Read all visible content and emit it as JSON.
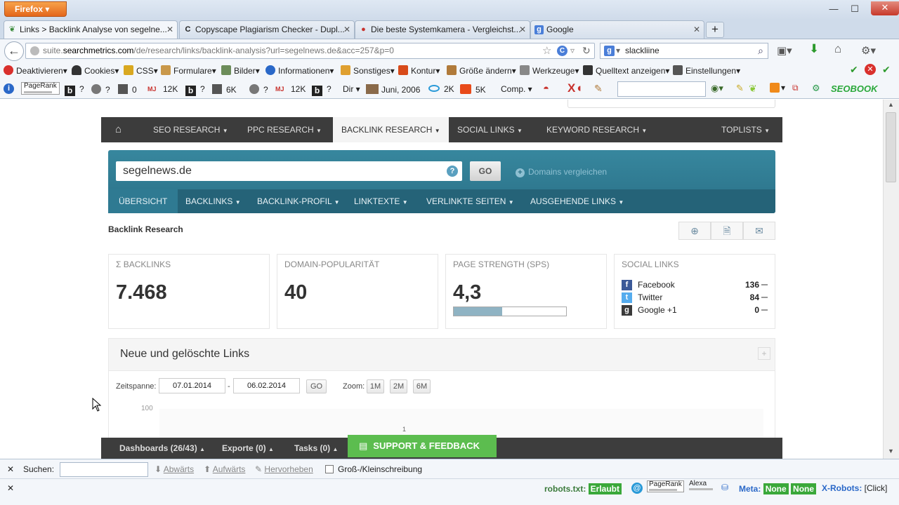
{
  "browser": {
    "app_button": "Firefox",
    "tabs": [
      {
        "label": "Links > Backlink Analyse von segelne...",
        "icon": "leaf-favicon-icon",
        "active": true
      },
      {
        "label": "Copyscape Plagiarism Checker - Dupl...",
        "icon": "copyscape-favicon-icon"
      },
      {
        "label": "Die beste Systemkamera - Vergleichst...",
        "icon": "camera-favicon-icon"
      },
      {
        "label": "Google",
        "icon": "google-favicon-icon"
      }
    ],
    "url_prefix": "suite.",
    "url_domain": "searchmetrics.com",
    "url_path": "/de/research/links/backlink-analysis?url=segelnews.de&acc=257&p=0",
    "search_value": "slackliine"
  },
  "toolbar1": {
    "items": [
      "Deaktivieren",
      "Cookies",
      "CSS",
      "Formulare",
      "Bilder",
      "Informationen",
      "Sonstiges",
      "Kontur",
      "Größe ändern",
      "Werkzeuge",
      "Quelltext anzeigen",
      "Einstellungen"
    ]
  },
  "toolbar2": {
    "pagerank": "PageRank",
    "q1": "?",
    "q2": "?",
    "v0": "0",
    "v12k": "12K",
    "q3": "?",
    "v6k": "6K",
    "q4": "?",
    "v12k2": "12K",
    "q5": "?",
    "dir": "Dir",
    "date": "Juni, 2006",
    "v2k": "2K",
    "v5k": "5K",
    "comp": "Comp.",
    "seobook": "SEOBOOK"
  },
  "site": {
    "topnav": [
      "SEO RESEARCH",
      "PPC RESEARCH",
      "BACKLINK RESEARCH",
      "SOCIAL LINKS",
      "KEYWORD RESEARCH",
      "TOPLISTS"
    ],
    "domain_value": "segelnews.de",
    "go": "GO",
    "compare": "Domains vergleichen",
    "subnav": [
      "ÜBERSICHT",
      "BACKLINKS",
      "BACKLINK-PROFIL",
      "LINKTEXTE",
      "VERLINKTE SEITEN",
      "AUSGEHENDE LINKS"
    ],
    "page_title": "Backlink Research",
    "cards": {
      "backlinks_label": "Σ BACKLINKS",
      "backlinks_value": "7.468",
      "domainpop_label": "DOMAIN-POPULARITÄT",
      "domainpop_value": "40",
      "strength_label": "PAGE STRENGTH (SPS)",
      "strength_value": "4,3",
      "strength_fraction": 0.43,
      "social_label": "SOCIAL LINKS",
      "social": [
        {
          "name": "Facebook",
          "value": "136",
          "color": "#3b5998",
          "glyph": "f"
        },
        {
          "name": "Twitter",
          "value": "84",
          "color": "#55acee",
          "glyph": "t"
        },
        {
          "name": "Google +1",
          "value": "0",
          "color": "#3a3a3a",
          "glyph": "g"
        }
      ]
    },
    "links_panel": {
      "title": "Neue und gelöschte Links",
      "period_label": "Zeitspanne:",
      "date_from": "07.01.2014",
      "date_sep": "-",
      "date_to": "06.02.2014",
      "go": "GO",
      "zoom_label": "Zoom:",
      "zoom": [
        "1M",
        "2M",
        "6M"
      ],
      "y_tick": "100",
      "point_label": "1"
    },
    "bottom": {
      "dashboards": "Dashboards (26/43)",
      "exporte": "Exporte (0)",
      "tasks": "Tasks (0)",
      "support": "SUPPORT & FEEDBACK"
    }
  },
  "findbar": {
    "label": "Suchen:",
    "down": "Abwärts",
    "up": "Aufwärts",
    "highlight": "Hervorheben",
    "case": "Groß-/Kleinschreibung"
  },
  "statusbar": {
    "robots_label": "robots.txt:",
    "robots_value": "Erlaubt",
    "pagerank": "PageRank",
    "alexa": "Alexa",
    "meta_label": "Meta:",
    "meta1": "None",
    "meta2": "None",
    "xrobots_label": "X-Robots:",
    "xrobots_value": "[Click]"
  }
}
